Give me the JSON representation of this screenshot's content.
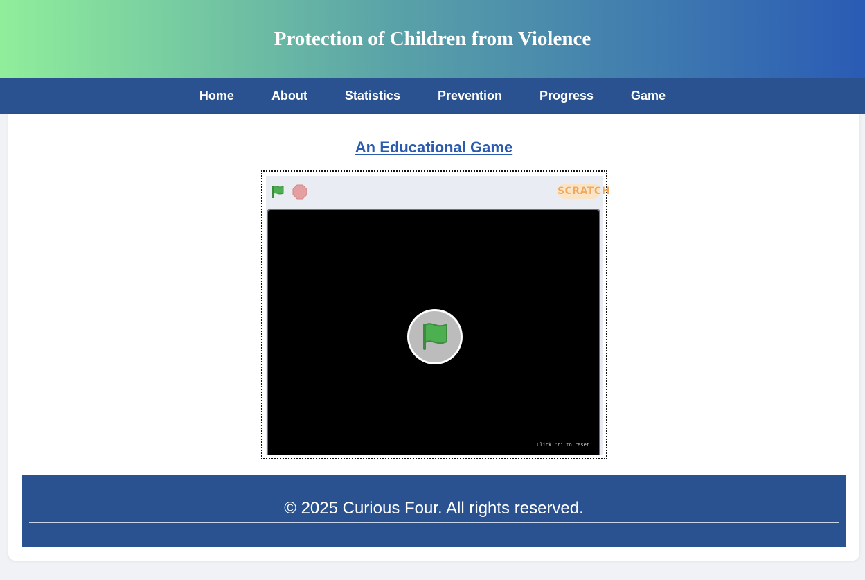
{
  "header": {
    "title": "Protection of Children from Violence"
  },
  "nav": {
    "items": [
      {
        "label": "Home"
      },
      {
        "label": "About"
      },
      {
        "label": "Statistics"
      },
      {
        "label": "Prevention"
      },
      {
        "label": "Progress"
      },
      {
        "label": "Game"
      }
    ]
  },
  "main": {
    "heading": "An Educational Game",
    "player": {
      "logo_text": "SCRATCH",
      "stage_hint": "Click \"r\" to reset",
      "icons": [
        "green-flag-icon",
        "stop-icon",
        "scratch-logo",
        "green-flag-overlay-icon"
      ]
    }
  },
  "footer": {
    "copyright": "© 2025 Curious Four. All rights reserved."
  },
  "colors": {
    "nav_bg": "#2a5291",
    "header_gradient_start": "#90ee9b",
    "header_gradient_end": "#2a5bb5",
    "link": "#2a5bb0",
    "flag_green": "#4caf50",
    "stop_red": "#e4a0a0"
  }
}
